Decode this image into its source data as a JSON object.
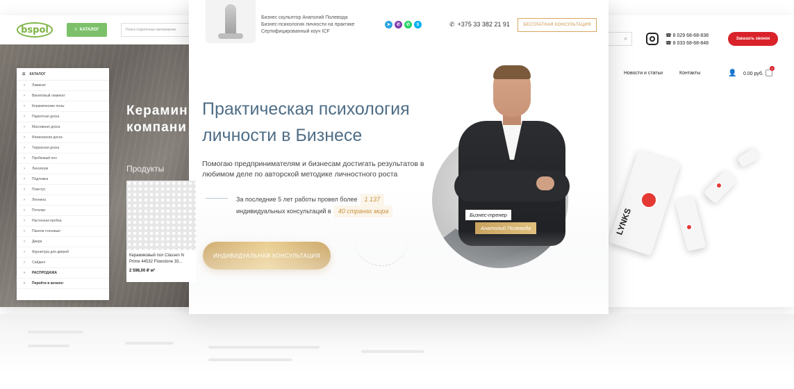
{
  "left_site": {
    "logo": "bspol",
    "catalog_button": "КАТАЛОГ",
    "search_placeholder": "Поиск отделочных материалов",
    "menu_title": "КАТАЛОГ",
    "menu_items": [
      "Ламинат",
      "Виниловый ламинат",
      "Керамические полы",
      "Паркетная доска",
      "Массивная доска",
      "Инженерная доска",
      "Террасная доска",
      "Пробковый пол",
      "Линолеум",
      "Подложка",
      "Плинтус",
      "Лепнина",
      "Потолки",
      "Настенная пробка",
      "Панели стеновые",
      "Двери",
      "Фурнитура для дверей",
      "Сайдинг",
      "РАСПРОДАЖА",
      "Перейти в каталог"
    ],
    "hero_title_1": "Керамин",
    "hero_title_2": "компани",
    "hero_subtitle": "Продукты",
    "product_name": "Керамиковый пол Classen N Prime 44532 Flowstone 33...",
    "product_price": "2 598,00 ₽ м²"
  },
  "center_site": {
    "tagline_1": "Бизнес скульптор Анатолий Полевода",
    "tagline_2": "Бизнес-психология личности на практике",
    "tagline_3": "Сертифицированный коуч ICF",
    "phone": "+375 33 382 21 91",
    "consult_button": "БЕСПЛАТНАЯ КОНСУЛЬТАЦИЯ",
    "title_1": "Практическая психология",
    "title_2": "личности в Бизнесе",
    "lead_1": "Помогаю предпринимателям и бизнесам достигать результатов в",
    "lead_2": "любимом деле по авторской методике личностного роста",
    "stats_pre": "За последние 5 лет работы провел более",
    "stats_count": "1 137",
    "stats_mid": "индивидуальных консультаций в",
    "stats_countries": "40 странах мира",
    "cta": "ИНДИВИДУАЛЬНАЯ КОНСУЛЬТАЦИЯ",
    "role_badge": "Бизнес-тренер",
    "name_badge": "Анатолий Полевода",
    "social": [
      "telegram-icon",
      "viber-icon",
      "whatsapp-icon",
      "skype-icon"
    ],
    "colors": {
      "telegram": "#2ca5e0",
      "viber": "#7d3daf",
      "whatsapp": "#25d366",
      "skype": "#00aff0",
      "gold": "#c9a25e",
      "title": "#4e6d86"
    }
  },
  "right_site": {
    "phone_1": "8 029 68-68-838",
    "phone_2": "8 033 68-68-848",
    "call_button": "Заказать звонок",
    "nav": [
      "Новости и статьи",
      "Контакты"
    ],
    "cart_total": "0.00 руб.",
    "cart_count": "0",
    "brand": "LYNKS",
    "colors": {
      "call": "#d9222a"
    }
  }
}
